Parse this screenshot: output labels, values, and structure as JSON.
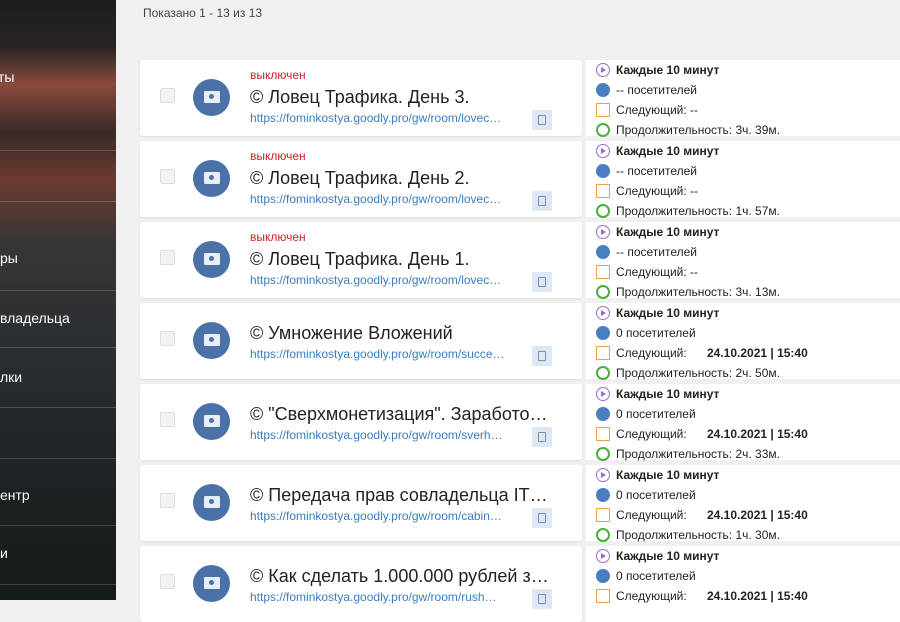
{
  "sidebar": {
    "items": [
      "ты",
      "ры",
      "владельца",
      "лки",
      "ентр",
      "и"
    ]
  },
  "shown": "Показано 1 - 13 из 13",
  "rows": [
    {
      "status": "выключен",
      "title": "© Ловец Трафика. День 3.",
      "url": "https://fominkostya.goodly.pro/gw/room/lovec…",
      "schedule": "Каждые 10 минут",
      "visitors": "-- посетителей",
      "next_label": "Следующий: --",
      "next_value": "",
      "duration": "Продолжительность: 3ч. 39м."
    },
    {
      "status": "выключен",
      "title": "© Ловец Трафика. День 2.",
      "url": "https://fominkostya.goodly.pro/gw/room/lovec…",
      "schedule": "Каждые 10 минут",
      "visitors": "-- посетителей",
      "next_label": "Следующий: --",
      "next_value": "",
      "duration": "Продолжительность: 1ч. 57м."
    },
    {
      "status": "выключен",
      "title": "© Ловец Трафика. День 1.",
      "url": "https://fominkostya.goodly.pro/gw/room/lovec…",
      "schedule": "Каждые 10 минут",
      "visitors": "-- посетителей",
      "next_label": "Следующий: --",
      "next_value": "",
      "duration": "Продолжительность: 3ч. 13м."
    },
    {
      "status": "",
      "title": "© Умножение Вложений",
      "url": "https://fominkostya.goodly.pro/gw/room/succe…",
      "schedule": "Каждые 10 минут",
      "visitors": "0 посетителей",
      "next_label": "Следующий:",
      "next_value": "24.10.2021 | 15:40",
      "duration": "Продолжительность: 2ч. 50м."
    },
    {
      "status": "",
      "title": "© \"Сверхмонетизация\". Заработо…",
      "url": "https://fominkostya.goodly.pro/gw/room/sverh…",
      "schedule": "Каждые 10 минут",
      "visitors": "0 посетителей",
      "next_label": "Следующий:",
      "next_value": "24.10.2021 | 15:40",
      "duration": "Продолжительность: 2ч. 33м."
    },
    {
      "status": "",
      "title": "© Передача прав совладельца IT…",
      "url": "https://fominkostya.goodly.pro/gw/room/cabin…",
      "schedule": "Каждые 10 минут",
      "visitors": "0 посетителей",
      "next_label": "Следующий:",
      "next_value": "24.10.2021 | 15:40",
      "duration": "Продолжительность: 1ч. 30м."
    },
    {
      "status": "",
      "title": "© Как сделать 1.000.000 рублей з…",
      "url": "https://fominkostya.goodly.pro/gw/room/rush…",
      "schedule": "Каждые 10 минут",
      "visitors": "0 посетителей",
      "next_label": "Следующий:",
      "next_value": "24.10.2021 | 15:40",
      "duration": ""
    }
  ]
}
